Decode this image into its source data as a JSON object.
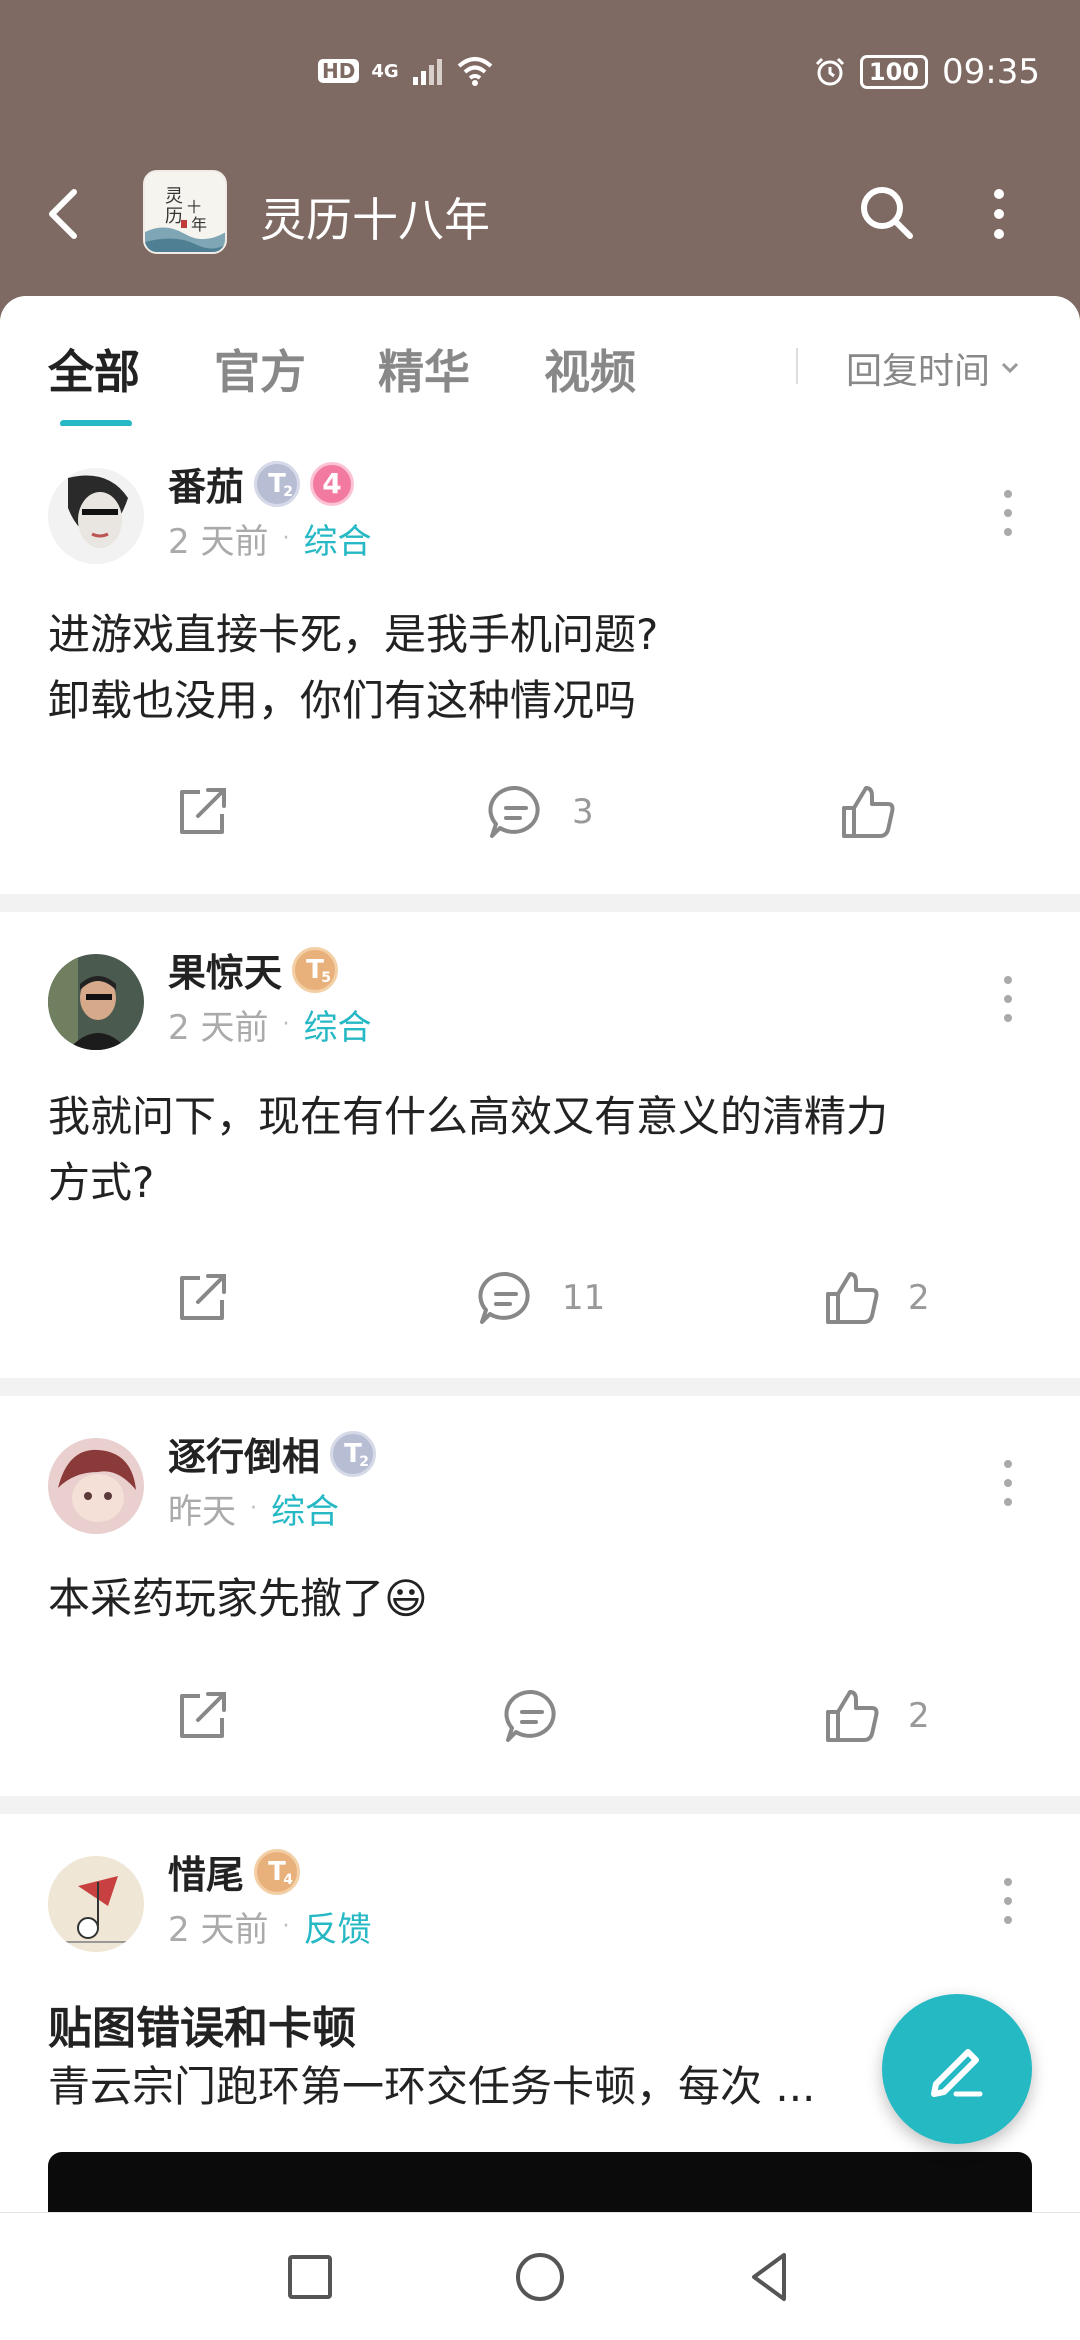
{
  "status_bar": {
    "hd": "HD",
    "network": "4G",
    "battery": "100",
    "time": "09:35"
  },
  "app_bar": {
    "title": "灵历十八年",
    "logo_text": "灵历十八年",
    "icons": [
      "back-icon",
      "search-icon",
      "more-icon"
    ]
  },
  "tabs": [
    {
      "label": "全部",
      "active": true
    },
    {
      "label": "官方",
      "active": false
    },
    {
      "label": "精华",
      "active": false
    },
    {
      "label": "视频",
      "active": false
    }
  ],
  "sort": {
    "label": "回复时间"
  },
  "colors": {
    "header": "#7f6a63",
    "accent": "#26b8c4"
  },
  "posts": [
    {
      "username": "番茄",
      "level_badge": "T",
      "level_num": "2",
      "extra_badge": "4",
      "time": "2 天前",
      "category": "综合",
      "text_lines": [
        "进游戏直接卡死，是我手机问题?",
        "卸载也没用，你们有这种情况吗"
      ],
      "comments": "3",
      "likes": ""
    },
    {
      "username": "果惊天",
      "level_badge": "T",
      "level_num": "5",
      "time": "2 天前",
      "category": "综合",
      "text_lines": [
        "我就问下，现在有什么高效又有意义的清精力",
        "方式?"
      ],
      "comments": "11",
      "likes": "2"
    },
    {
      "username": "逐行倒相",
      "level_badge": "T",
      "level_num": "2",
      "time": "昨天",
      "category": "综合",
      "text_lines": [
        "本采药玩家先撤了😃"
      ],
      "comments": "",
      "likes": "2"
    },
    {
      "username": "惜尾",
      "level_badge": "T",
      "level_num": "4",
      "time": "2 天前",
      "category": "反馈",
      "title": "贴图错误和卡顿",
      "text_lines": [
        "青云宗门跑环第一环交任务卡顿，每次 ..."
      ]
    }
  ]
}
